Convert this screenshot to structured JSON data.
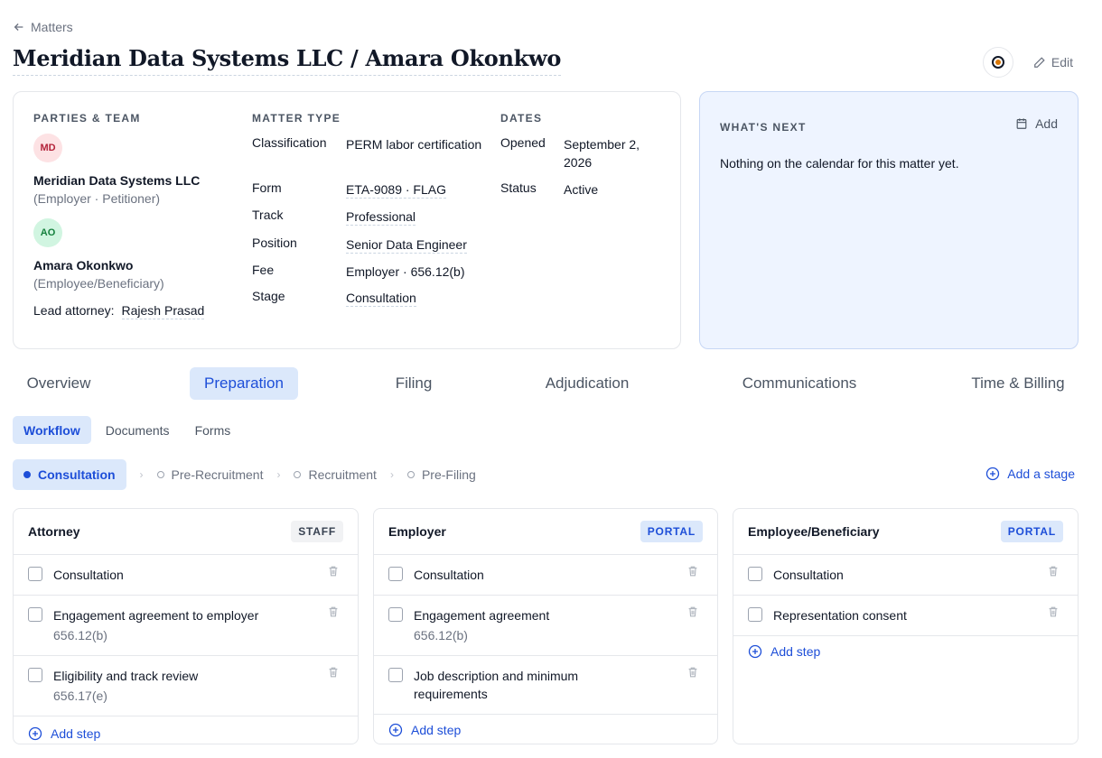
{
  "nav": {
    "back_label": "Matters"
  },
  "page": {
    "title": "Meridian Data Systems LLC / Amara Okonkwo"
  },
  "actions": {
    "edit_label": "Edit"
  },
  "info": {
    "parties_label": "PARTIES & TEAM",
    "parties": [
      {
        "initials": "MD",
        "name": "Meridian Data Systems LLC",
        "role": "(Employer · Petitioner)"
      },
      {
        "initials": "AO",
        "name": "Amara Okonkwo",
        "role": "(Employee/Beneficiary)"
      }
    ],
    "lead_label": "Lead attorney:",
    "lead_value": "Rajesh Prasad",
    "matter_type_label": "MATTER TYPE",
    "matter_fields": [
      {
        "key": "Classification",
        "value": "PERM labor certification"
      },
      {
        "key": "Form",
        "value": "ETA-9089 · FLAG"
      },
      {
        "key": "Track",
        "value": "Professional"
      },
      {
        "key": "Position",
        "value": "Senior Data Engineer"
      },
      {
        "key": "Fee",
        "value": "Employer · 656.12(b)"
      },
      {
        "key": "Stage",
        "value": "Consultation"
      }
    ],
    "dates_label": "DATES",
    "date_fields": [
      {
        "key": "Opened",
        "value": "September 2, 2026"
      },
      {
        "key": "Status",
        "value": "Active"
      }
    ]
  },
  "next": {
    "label": "WHAT'S NEXT",
    "add_label": "Add",
    "empty_text": "Nothing on the calendar for this matter yet."
  },
  "tabs": [
    "Overview",
    "Preparation",
    "Filing",
    "Adjudication",
    "Communications",
    "Time & Billing"
  ],
  "active_tab": "Preparation",
  "subtabs": [
    "Workflow",
    "Documents",
    "Forms"
  ],
  "active_subtab": "Workflow",
  "stages": [
    "Consultation",
    "Pre-Recruitment",
    "Recruitment",
    "Pre-Filing"
  ],
  "active_stage": "Consultation",
  "add_stage_label": "Add a stage",
  "add_step_label": "Add step",
  "columns": [
    {
      "title": "Attorney",
      "badge": "STAFF",
      "steps": [
        {
          "label": "Consultation",
          "sub": ""
        },
        {
          "label": "Engagement agreement to employer",
          "sub": "656.12(b)"
        },
        {
          "label": "Eligibility and track review",
          "sub": "656.17(e)"
        }
      ]
    },
    {
      "title": "Employer",
      "badge": "PORTAL",
      "steps": [
        {
          "label": "Consultation",
          "sub": ""
        },
        {
          "label": "Engagement agreement",
          "sub": "656.12(b)"
        },
        {
          "label": "Job description and minimum requirements",
          "sub": ""
        }
      ]
    },
    {
      "title": "Employee/Beneficiary",
      "badge": "PORTAL",
      "steps": [
        {
          "label": "Consultation",
          "sub": ""
        },
        {
          "label": "Representation consent",
          "sub": ""
        }
      ]
    }
  ]
}
